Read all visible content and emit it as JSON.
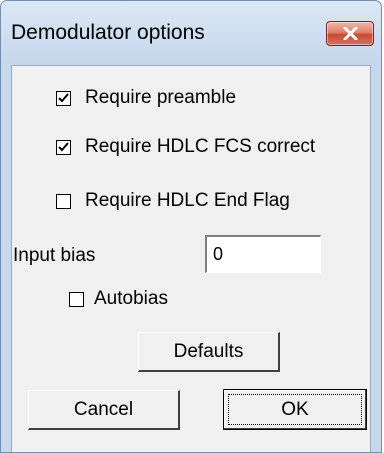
{
  "window": {
    "title": "Demodulator options"
  },
  "options": {
    "require_preamble": {
      "label": "Require preamble",
      "checked": true
    },
    "require_hdlc_fcs": {
      "label": "Require HDLC FCS correct",
      "checked": true
    },
    "require_hdlc_end_flag": {
      "label": "Require HDLC End Flag",
      "checked": false
    }
  },
  "input_bias": {
    "label": "Input bias",
    "value": "0"
  },
  "autobias": {
    "label": "Autobias",
    "checked": false
  },
  "buttons": {
    "defaults": "Defaults",
    "cancel": "Cancel",
    "ok": "OK"
  },
  "colors": {
    "frame": "#c6d8ec",
    "client": "#f0f0f0",
    "close_button": "#c94a33"
  },
  "icons": {
    "close": "close-x-icon",
    "check": "checkmark-icon"
  }
}
